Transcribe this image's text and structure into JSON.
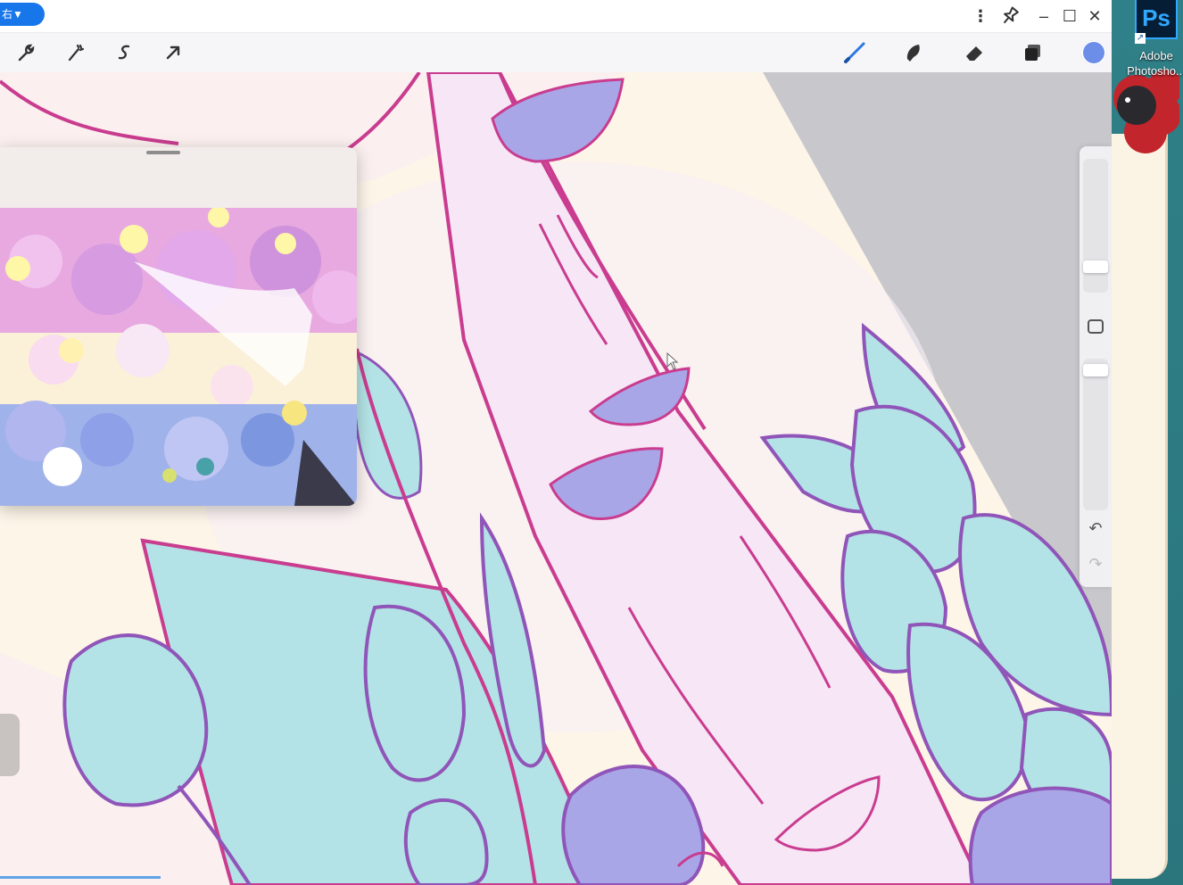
{
  "titlebar": {
    "badge_label": "右▼",
    "menu_glyph": "⋮",
    "pin_glyph": "📌",
    "minimize_glyph": "–",
    "maximize_glyph": "☐",
    "close_glyph": "✕"
  },
  "toolbar": {
    "left_tools": [
      "wrench-icon",
      "magic-wand-icon",
      "selection-icon",
      "transform-arrow-icon"
    ],
    "right_tools": [
      "brush-icon",
      "smudge-icon",
      "eraser-icon",
      "layers-icon"
    ],
    "active_color": "#6d8ee8"
  },
  "sidebar": {
    "undo_glyph": "↶",
    "redo_glyph": "↷"
  },
  "desktop": {
    "shortcut_icon_text": "Ps",
    "shortcut_arrow": "↗",
    "shortcut_label": "Adobe\nPhotosho..."
  },
  "palette": {
    "canvas_bg": "#fbf1f2",
    "stroke": "#c93c8f",
    "leaf": "#b3e3e6",
    "berry": "#a9a6e8",
    "flower_red": "#c2262c"
  }
}
